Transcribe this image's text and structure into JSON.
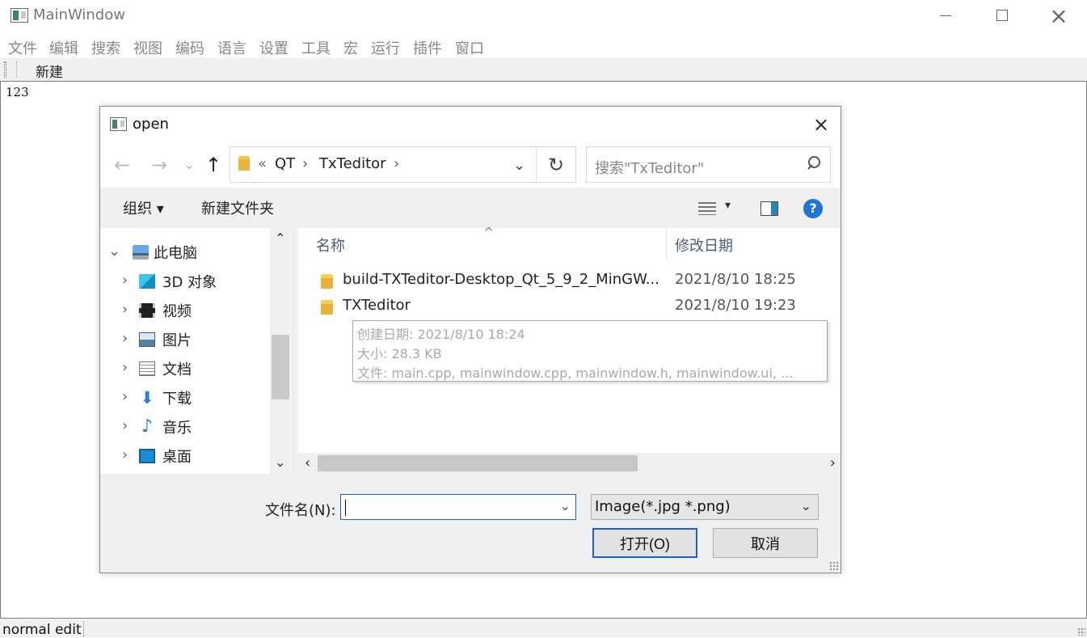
{
  "window": {
    "title": "MainWindow",
    "controls": {
      "minimize": "minimize-icon",
      "maximize": "maximize-icon",
      "close": "×"
    }
  },
  "menu": [
    "文件",
    "编辑",
    "搜索",
    "视图",
    "编码",
    "语言",
    "设置",
    "工具",
    "宏",
    "运行",
    "插件",
    "窗口"
  ],
  "toolbar": {
    "new_label": "新建"
  },
  "editor": {
    "text": "123"
  },
  "statusbar": {
    "text": "normal edit"
  },
  "dialog": {
    "title": "open",
    "close": "×",
    "navigation": {
      "back": "←",
      "forward": "→",
      "recent": "⌄",
      "up": "↑",
      "breadcrumb": {
        "overflow": "«",
        "parts": [
          "QT",
          "TxTeditor"
        ],
        "separator": "›",
        "dropdown": "⌄"
      },
      "refresh": "↻"
    },
    "search": {
      "placeholder": "搜索\"TxTeditor\""
    },
    "commands": {
      "organize": "组织 ▾",
      "new_folder": "新建文件夹",
      "view_dropdown": "▾",
      "help": "?"
    },
    "tree": [
      {
        "label": "此电脑",
        "icon": "computer-icon",
        "expanded": true
      },
      {
        "label": "3D 对象",
        "icon": "cube-icon"
      },
      {
        "label": "视频",
        "icon": "video-icon"
      },
      {
        "label": "图片",
        "icon": "picture-icon"
      },
      {
        "label": "文档",
        "icon": "document-icon"
      },
      {
        "label": "下载",
        "icon": "download-icon"
      },
      {
        "label": "音乐",
        "icon": "music-icon"
      },
      {
        "label": "桌面",
        "icon": "desktop-icon"
      }
    ],
    "tree_scroll": {
      "up": "⌃",
      "down": "⌄"
    },
    "columns": {
      "name": "名称",
      "date": "修改日期",
      "sort_indicator": "^"
    },
    "files": [
      {
        "name": "build-TXTeditor-Desktop_Qt_5_9_2_MinGW...",
        "date": "2021/8/10 18:25",
        "icon": "folder-icon"
      },
      {
        "name": "TXTeditor",
        "date": "2021/8/10 19:23",
        "icon": "folder-icon"
      }
    ],
    "tooltip": {
      "created": "创建日期: 2021/8/10 18:24",
      "size": "大小: 28.3 KB",
      "files": "文件: main.cpp, mainwindow.cpp, mainwindow.h, mainwindow.ui, ..."
    },
    "hscroll": {
      "left": "‹",
      "right": "›"
    },
    "footer": {
      "filename_label": "文件名(N):",
      "filename_value": "",
      "filename_dropdown": "⌄",
      "filter_value": "Image(*.jpg *.png)",
      "filter_dropdown": "⌄",
      "open_button": "打开(O)",
      "cancel_button": "取消"
    }
  }
}
